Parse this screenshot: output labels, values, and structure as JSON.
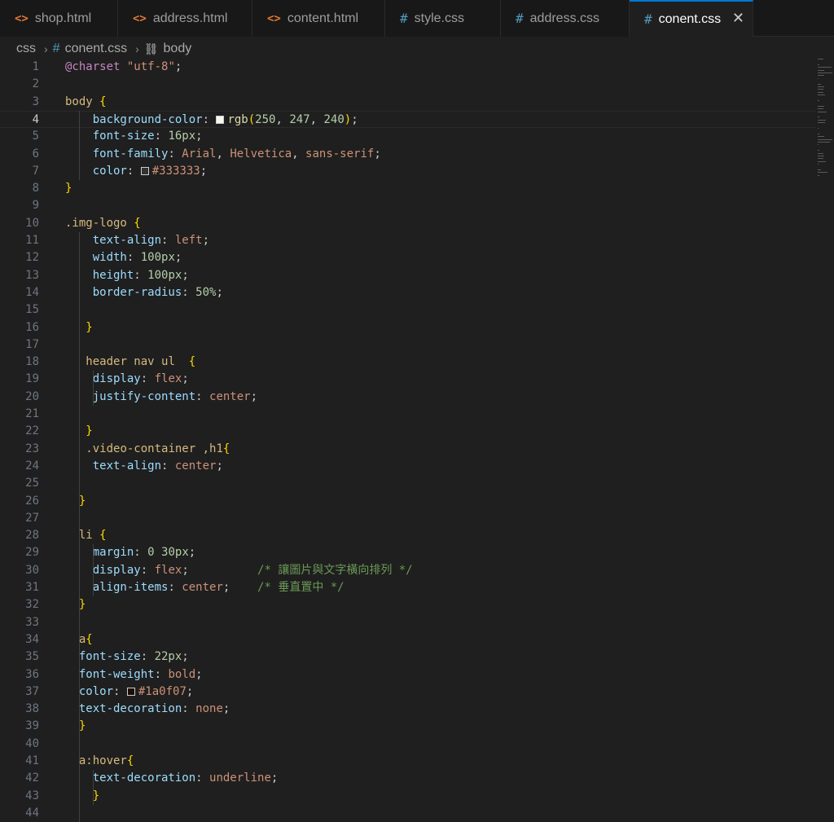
{
  "tabs": [
    {
      "label": "shop.html",
      "icon": "html-file-icon",
      "icon_glyph": "<>"
    },
    {
      "label": "address.html",
      "icon": "html-file-icon",
      "icon_glyph": "<>"
    },
    {
      "label": "content.html",
      "icon": "html-file-icon",
      "icon_glyph": "<>"
    },
    {
      "label": "style.css",
      "icon": "css-file-icon",
      "icon_glyph": "#"
    },
    {
      "label": "address.css",
      "icon": "css-file-icon",
      "icon_glyph": "#"
    },
    {
      "label": "conent.css",
      "icon": "css-file-icon",
      "icon_glyph": "#",
      "active": true,
      "close_glyph": "✕"
    }
  ],
  "breadcrumb": {
    "folder": "css",
    "file": "conent.css",
    "symbol": "body",
    "separator": "›",
    "hash_glyph": "#",
    "symbol_glyph": "⛓"
  },
  "editor": {
    "current_line": 4,
    "colors": {
      "accent": "#0078d4",
      "background": "#1f1f1f",
      "selector": "#d7ba7d",
      "property": "#9cdcfe",
      "value": "#ce9178",
      "number": "#b5cea8",
      "comment": "#6a9955",
      "brace": "#ffd700"
    },
    "lines": [
      {
        "n": "1",
        "tokens": [
          [
            "at",
            "@charset"
          ],
          [
            "pn",
            " "
          ],
          [
            "str",
            "\"utf-8\""
          ],
          [
            "pn",
            ";"
          ]
        ]
      },
      {
        "n": "2",
        "tokens": []
      },
      {
        "n": "3",
        "tokens": [
          [
            "sel",
            "body"
          ],
          [
            "pn",
            " "
          ],
          [
            "brace",
            "{"
          ]
        ]
      },
      {
        "n": "4",
        "tokens": [
          [
            "pn",
            "    "
          ],
          [
            "prop",
            "background-color"
          ],
          [
            "pn",
            ": "
          ],
          [
            "swatch",
            "#faf7f0"
          ],
          [
            "fn",
            "rgb"
          ],
          [
            "brace",
            "("
          ],
          [
            "num",
            "250"
          ],
          [
            "pn",
            ", "
          ],
          [
            "num",
            "247"
          ],
          [
            "pn",
            ", "
          ],
          [
            "num",
            "240"
          ],
          [
            "brace",
            ")"
          ],
          [
            "pn",
            ";"
          ]
        ]
      },
      {
        "n": "5",
        "tokens": [
          [
            "pn",
            "    "
          ],
          [
            "prop",
            "font-size"
          ],
          [
            "pn",
            ": "
          ],
          [
            "num",
            "16px"
          ],
          [
            "pn",
            ";"
          ]
        ]
      },
      {
        "n": "6",
        "tokens": [
          [
            "pn",
            "    "
          ],
          [
            "prop",
            "font-family"
          ],
          [
            "pn",
            ": "
          ],
          [
            "val",
            "Arial"
          ],
          [
            "pn",
            ", "
          ],
          [
            "val",
            "Helvetica"
          ],
          [
            "pn",
            ", "
          ],
          [
            "val",
            "sans-serif"
          ],
          [
            "pn",
            ";"
          ]
        ]
      },
      {
        "n": "7",
        "tokens": [
          [
            "pn",
            "    "
          ],
          [
            "prop",
            "color"
          ],
          [
            "pn",
            ": "
          ],
          [
            "swatch",
            "#333333"
          ],
          [
            "val",
            "#333333"
          ],
          [
            "pn",
            ";"
          ]
        ]
      },
      {
        "n": "8",
        "tokens": [
          [
            "brace",
            "}"
          ]
        ]
      },
      {
        "n": "9",
        "tokens": []
      },
      {
        "n": "10",
        "tokens": [
          [
            "sel",
            ".img-logo"
          ],
          [
            "pn",
            " "
          ],
          [
            "brace",
            "{"
          ]
        ]
      },
      {
        "n": "11",
        "tokens": [
          [
            "pn",
            "    "
          ],
          [
            "prop",
            "text-align"
          ],
          [
            "pn",
            ": "
          ],
          [
            "val",
            "left"
          ],
          [
            "pn",
            ";"
          ]
        ]
      },
      {
        "n": "12",
        "tokens": [
          [
            "pn",
            "    "
          ],
          [
            "prop",
            "width"
          ],
          [
            "pn",
            ": "
          ],
          [
            "num",
            "100px"
          ],
          [
            "pn",
            ";"
          ]
        ]
      },
      {
        "n": "13",
        "tokens": [
          [
            "pn",
            "    "
          ],
          [
            "prop",
            "height"
          ],
          [
            "pn",
            ": "
          ],
          [
            "num",
            "100px"
          ],
          [
            "pn",
            ";"
          ]
        ]
      },
      {
        "n": "14",
        "tokens": [
          [
            "pn",
            "    "
          ],
          [
            "prop",
            "border-radius"
          ],
          [
            "pn",
            ": "
          ],
          [
            "num",
            "50%"
          ],
          [
            "pn",
            ";"
          ]
        ]
      },
      {
        "n": "15",
        "tokens": []
      },
      {
        "n": "16",
        "tokens": [
          [
            "pn",
            "   "
          ],
          [
            "brace",
            "}"
          ]
        ]
      },
      {
        "n": "17",
        "tokens": []
      },
      {
        "n": "18",
        "tokens": [
          [
            "pn",
            "   "
          ],
          [
            "sel",
            "header nav ul"
          ],
          [
            "pn",
            "  "
          ],
          [
            "brace",
            "{"
          ]
        ]
      },
      {
        "n": "19",
        "tokens": [
          [
            "pn",
            "    "
          ],
          [
            "prop",
            "display"
          ],
          [
            "pn",
            ": "
          ],
          [
            "val",
            "flex"
          ],
          [
            "pn",
            ";"
          ]
        ]
      },
      {
        "n": "20",
        "tokens": [
          [
            "pn",
            "    "
          ],
          [
            "prop",
            "justify-content"
          ],
          [
            "pn",
            ": "
          ],
          [
            "val",
            "center"
          ],
          [
            "pn",
            ";"
          ]
        ]
      },
      {
        "n": "21",
        "tokens": []
      },
      {
        "n": "22",
        "tokens": [
          [
            "pn",
            "   "
          ],
          [
            "brace",
            "}"
          ]
        ]
      },
      {
        "n": "23",
        "tokens": [
          [
            "pn",
            "   "
          ],
          [
            "sel",
            ".video-container ,h1"
          ],
          [
            "brace",
            "{"
          ]
        ]
      },
      {
        "n": "24",
        "tokens": [
          [
            "pn",
            "    "
          ],
          [
            "prop",
            "text-align"
          ],
          [
            "pn",
            ": "
          ],
          [
            "val",
            "center"
          ],
          [
            "pn",
            ";"
          ]
        ]
      },
      {
        "n": "25",
        "tokens": []
      },
      {
        "n": "26",
        "tokens": [
          [
            "pn",
            "  "
          ],
          [
            "brace",
            "}"
          ]
        ]
      },
      {
        "n": "27",
        "tokens": []
      },
      {
        "n": "28",
        "tokens": [
          [
            "pn",
            "  "
          ],
          [
            "sel",
            "li"
          ],
          [
            "pn",
            " "
          ],
          [
            "brace",
            "{"
          ]
        ]
      },
      {
        "n": "29",
        "tokens": [
          [
            "pn",
            "    "
          ],
          [
            "prop",
            "margin"
          ],
          [
            "pn",
            ": "
          ],
          [
            "num",
            "0"
          ],
          [
            "pn",
            " "
          ],
          [
            "num",
            "30px"
          ],
          [
            "pn",
            ";"
          ]
        ]
      },
      {
        "n": "30",
        "tokens": [
          [
            "pn",
            "    "
          ],
          [
            "prop",
            "display"
          ],
          [
            "pn",
            ": "
          ],
          [
            "val",
            "flex"
          ],
          [
            "pn",
            ";          "
          ],
          [
            "com",
            "/* 讓圖片與文字橫向排列 */"
          ]
        ]
      },
      {
        "n": "31",
        "tokens": [
          [
            "pn",
            "    "
          ],
          [
            "prop",
            "align-items"
          ],
          [
            "pn",
            ": "
          ],
          [
            "val",
            "center"
          ],
          [
            "pn",
            ";    "
          ],
          [
            "com",
            "/* 垂直置中 */"
          ]
        ]
      },
      {
        "n": "32",
        "tokens": [
          [
            "pn",
            "  "
          ],
          [
            "brace",
            "}"
          ]
        ]
      },
      {
        "n": "33",
        "tokens": []
      },
      {
        "n": "34",
        "tokens": [
          [
            "pn",
            "  "
          ],
          [
            "sel",
            "a"
          ],
          [
            "brace",
            "{"
          ]
        ]
      },
      {
        "n": "35",
        "tokens": [
          [
            "pn",
            "  "
          ],
          [
            "prop",
            "font-size"
          ],
          [
            "pn",
            ": "
          ],
          [
            "num",
            "22px"
          ],
          [
            "pn",
            ";"
          ]
        ]
      },
      {
        "n": "36",
        "tokens": [
          [
            "pn",
            "  "
          ],
          [
            "prop",
            "font-weight"
          ],
          [
            "pn",
            ": "
          ],
          [
            "val",
            "bold"
          ],
          [
            "pn",
            ";"
          ]
        ]
      },
      {
        "n": "37",
        "tokens": [
          [
            "pn",
            "  "
          ],
          [
            "prop",
            "color"
          ],
          [
            "pn",
            ": "
          ],
          [
            "swatch",
            "#1a0f07"
          ],
          [
            "val",
            "#1a0f07"
          ],
          [
            "pn",
            ";"
          ]
        ]
      },
      {
        "n": "38",
        "tokens": [
          [
            "pn",
            "  "
          ],
          [
            "prop",
            "text-decoration"
          ],
          [
            "pn",
            ": "
          ],
          [
            "val",
            "none"
          ],
          [
            "pn",
            ";"
          ]
        ]
      },
      {
        "n": "39",
        "tokens": [
          [
            "pn",
            "  "
          ],
          [
            "brace",
            "}"
          ]
        ]
      },
      {
        "n": "40",
        "tokens": []
      },
      {
        "n": "41",
        "tokens": [
          [
            "pn",
            "  "
          ],
          [
            "sel",
            "a:hover"
          ],
          [
            "brace",
            "{"
          ]
        ]
      },
      {
        "n": "42",
        "tokens": [
          [
            "pn",
            "    "
          ],
          [
            "prop",
            "text-decoration"
          ],
          [
            "pn",
            ": "
          ],
          [
            "val",
            "underline"
          ],
          [
            "pn",
            ";"
          ]
        ]
      },
      {
        "n": "43",
        "tokens": [
          [
            "pn",
            "    "
          ],
          [
            "brace",
            "}"
          ]
        ]
      },
      {
        "n": "44",
        "tokens": []
      }
    ]
  }
}
